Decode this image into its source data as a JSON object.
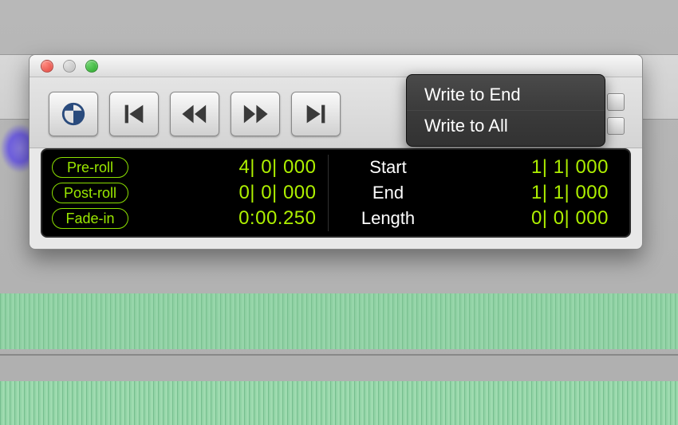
{
  "menu": {
    "items": [
      "Write to End",
      "Write to All"
    ]
  },
  "transport": {
    "buttons": [
      "online",
      "go-to-start",
      "rewind",
      "fast-forward",
      "go-to-end"
    ]
  },
  "counters": {
    "left": [
      {
        "label": "Pre-roll",
        "value": "4| 0| 000"
      },
      {
        "label": "Post-roll",
        "value": "0| 0| 000"
      },
      {
        "label": "Fade-in",
        "value": "0:00.250"
      }
    ],
    "right": [
      {
        "label": "Start",
        "value": "1| 1| 000"
      },
      {
        "label": "End",
        "value": "1| 1| 000"
      },
      {
        "label": "Length",
        "value": "0| 0| 000"
      }
    ]
  },
  "colors": {
    "accent_green": "#9ae800",
    "menu_bg": "#3b3b3b"
  }
}
